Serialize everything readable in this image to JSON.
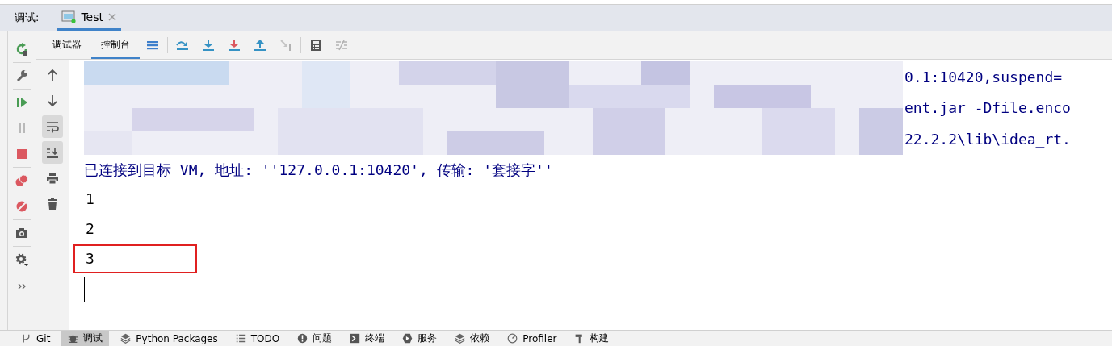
{
  "panel": {
    "label": "调试:",
    "tabs": [
      {
        "label": "Test",
        "selected": true
      }
    ]
  },
  "toolbar": {
    "tabs": [
      {
        "label": "调试器",
        "selected": false
      },
      {
        "label": "控制台",
        "selected": true
      }
    ],
    "buttons": [
      {
        "kind": "menu",
        "disabled": false
      },
      {
        "kind": "step-over",
        "disabled": false
      },
      {
        "kind": "step-into",
        "disabled": false
      },
      {
        "kind": "force-step-into",
        "disabled": false
      },
      {
        "kind": "step-out",
        "disabled": false
      },
      {
        "kind": "run-to-cursor",
        "disabled": true
      },
      {
        "kind": "evaluate",
        "disabled": false
      },
      {
        "kind": "trace",
        "disabled": true
      }
    ]
  },
  "side_buttons": [
    {
      "kind": "rerun",
      "disabled": false
    },
    {
      "kind": "wrench",
      "disabled": false
    },
    {
      "kind": "resume",
      "disabled": false
    },
    {
      "kind": "pause",
      "disabled": true
    },
    {
      "kind": "stop",
      "disabled": false
    },
    {
      "kind": "breakpoints",
      "disabled": false
    },
    {
      "kind": "mute",
      "disabled": false
    },
    {
      "kind": "camera",
      "disabled": false
    },
    {
      "kind": "gear",
      "disabled": false
    },
    {
      "kind": "more",
      "disabled": false
    }
  ],
  "console_buttons": [
    {
      "kind": "up",
      "on": false
    },
    {
      "kind": "down",
      "on": false
    },
    {
      "kind": "wrap",
      "on": true
    },
    {
      "kind": "scroll-end",
      "on": true
    },
    {
      "kind": "print",
      "on": false
    },
    {
      "kind": "trash",
      "on": false
    }
  ],
  "console": {
    "command_tail": [
      "0.1:10420,suspend=",
      "ent.jar -Dfile.enco",
      "22.2.2\\lib\\idea_rt."
    ],
    "message": "已连接到目标 VM, 地址: ''127.0.0.1:10420', 传输: '套接字''",
    "output": [
      {
        "text": "1",
        "highlighted": false
      },
      {
        "text": "2",
        "highlighted": false
      },
      {
        "text": "3",
        "highlighted": true
      }
    ]
  },
  "tool_windows": [
    {
      "kind": "git",
      "label": "Git",
      "selected": false
    },
    {
      "kind": "debug",
      "label": "调试",
      "selected": true
    },
    {
      "kind": "packages",
      "label": "Python Packages",
      "selected": false
    },
    {
      "kind": "list",
      "label": "TODO",
      "selected": false
    },
    {
      "kind": "problems",
      "label": "问题",
      "selected": false
    },
    {
      "kind": "terminal",
      "label": "终端",
      "selected": false
    },
    {
      "kind": "services",
      "label": "服务",
      "selected": false
    },
    {
      "kind": "packages",
      "label": "依赖",
      "selected": false
    },
    {
      "kind": "profiler",
      "label": "Profiler",
      "selected": false
    },
    {
      "kind": "build",
      "label": "构建",
      "selected": false
    }
  ]
}
